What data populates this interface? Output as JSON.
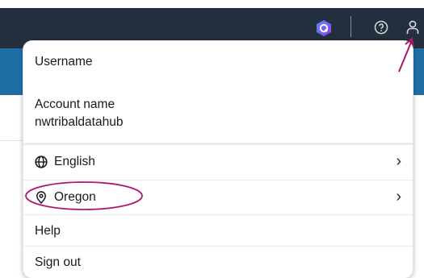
{
  "topnav": {
    "icons": [
      "amazon-q-icon",
      "help-circle-icon",
      "user-icon"
    ],
    "colors": {
      "bar": "#232f3e",
      "band": "#1f6fa6"
    }
  },
  "menu": {
    "username_label": "Username",
    "account_label": "Account name",
    "account_value": "nwtribaldatahub",
    "language": "English",
    "region": "Oregon",
    "help": "Help",
    "signout": "Sign out",
    "chevron": "›"
  },
  "annotation": {
    "color": "#b0166e"
  }
}
